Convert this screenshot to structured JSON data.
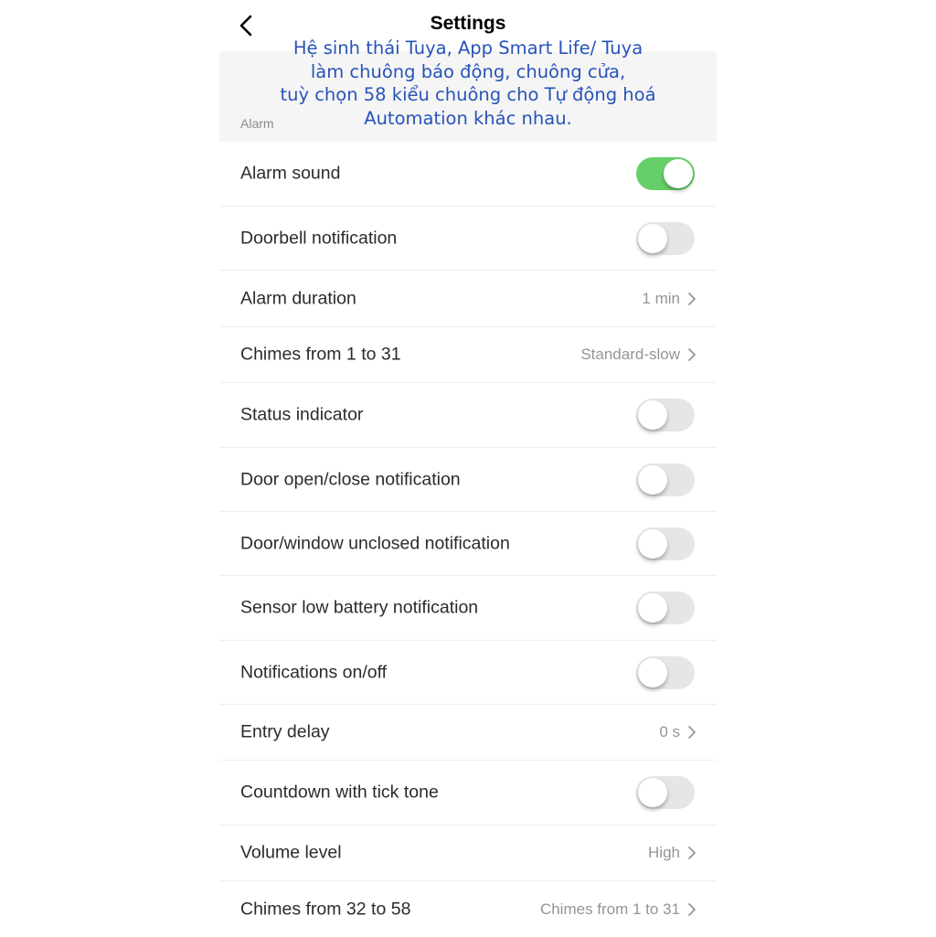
{
  "navbar": {
    "title": "Settings",
    "back_icon": "chevron-left-icon"
  },
  "overlay_caption": "Hệ sinh thái Tuya, App Smart Life/ Tuya\nlàm chuông báo động, chuông cửa,\ntuỳ chọn 58 kiểu chuông cho Tự động hoá\nAutomation khác nhau.",
  "section": {
    "label": "Alarm"
  },
  "colors": {
    "toggle_on": "#67cf6a",
    "toggle_off": "#e6e6e6",
    "caption": "#2753b8"
  },
  "rows": [
    {
      "label": "Alarm sound",
      "type": "toggle",
      "on": true
    },
    {
      "label": "Doorbell notification",
      "type": "toggle",
      "on": false
    },
    {
      "label": "Alarm duration",
      "type": "value",
      "value": "1 min"
    },
    {
      "label": "Chimes from 1 to 31",
      "type": "value",
      "value": "Standard-slow"
    },
    {
      "label": "Status indicator",
      "type": "toggle",
      "on": false
    },
    {
      "label": "Door open/close notification",
      "type": "toggle",
      "on": false
    },
    {
      "label": "Door/window unclosed notification",
      "type": "toggle",
      "on": false
    },
    {
      "label": "Sensor low battery notification",
      "type": "toggle",
      "on": false
    },
    {
      "label": "Notifications on/off",
      "type": "toggle",
      "on": false
    },
    {
      "label": "Entry delay",
      "type": "value",
      "value": "0 s"
    },
    {
      "label": "Countdown with tick tone",
      "type": "toggle",
      "on": false
    },
    {
      "label": "Volume level",
      "type": "value",
      "value": "High"
    },
    {
      "label": "Chimes from 32 to 58",
      "type": "value",
      "value": "Chimes from 1 to 31"
    }
  ]
}
